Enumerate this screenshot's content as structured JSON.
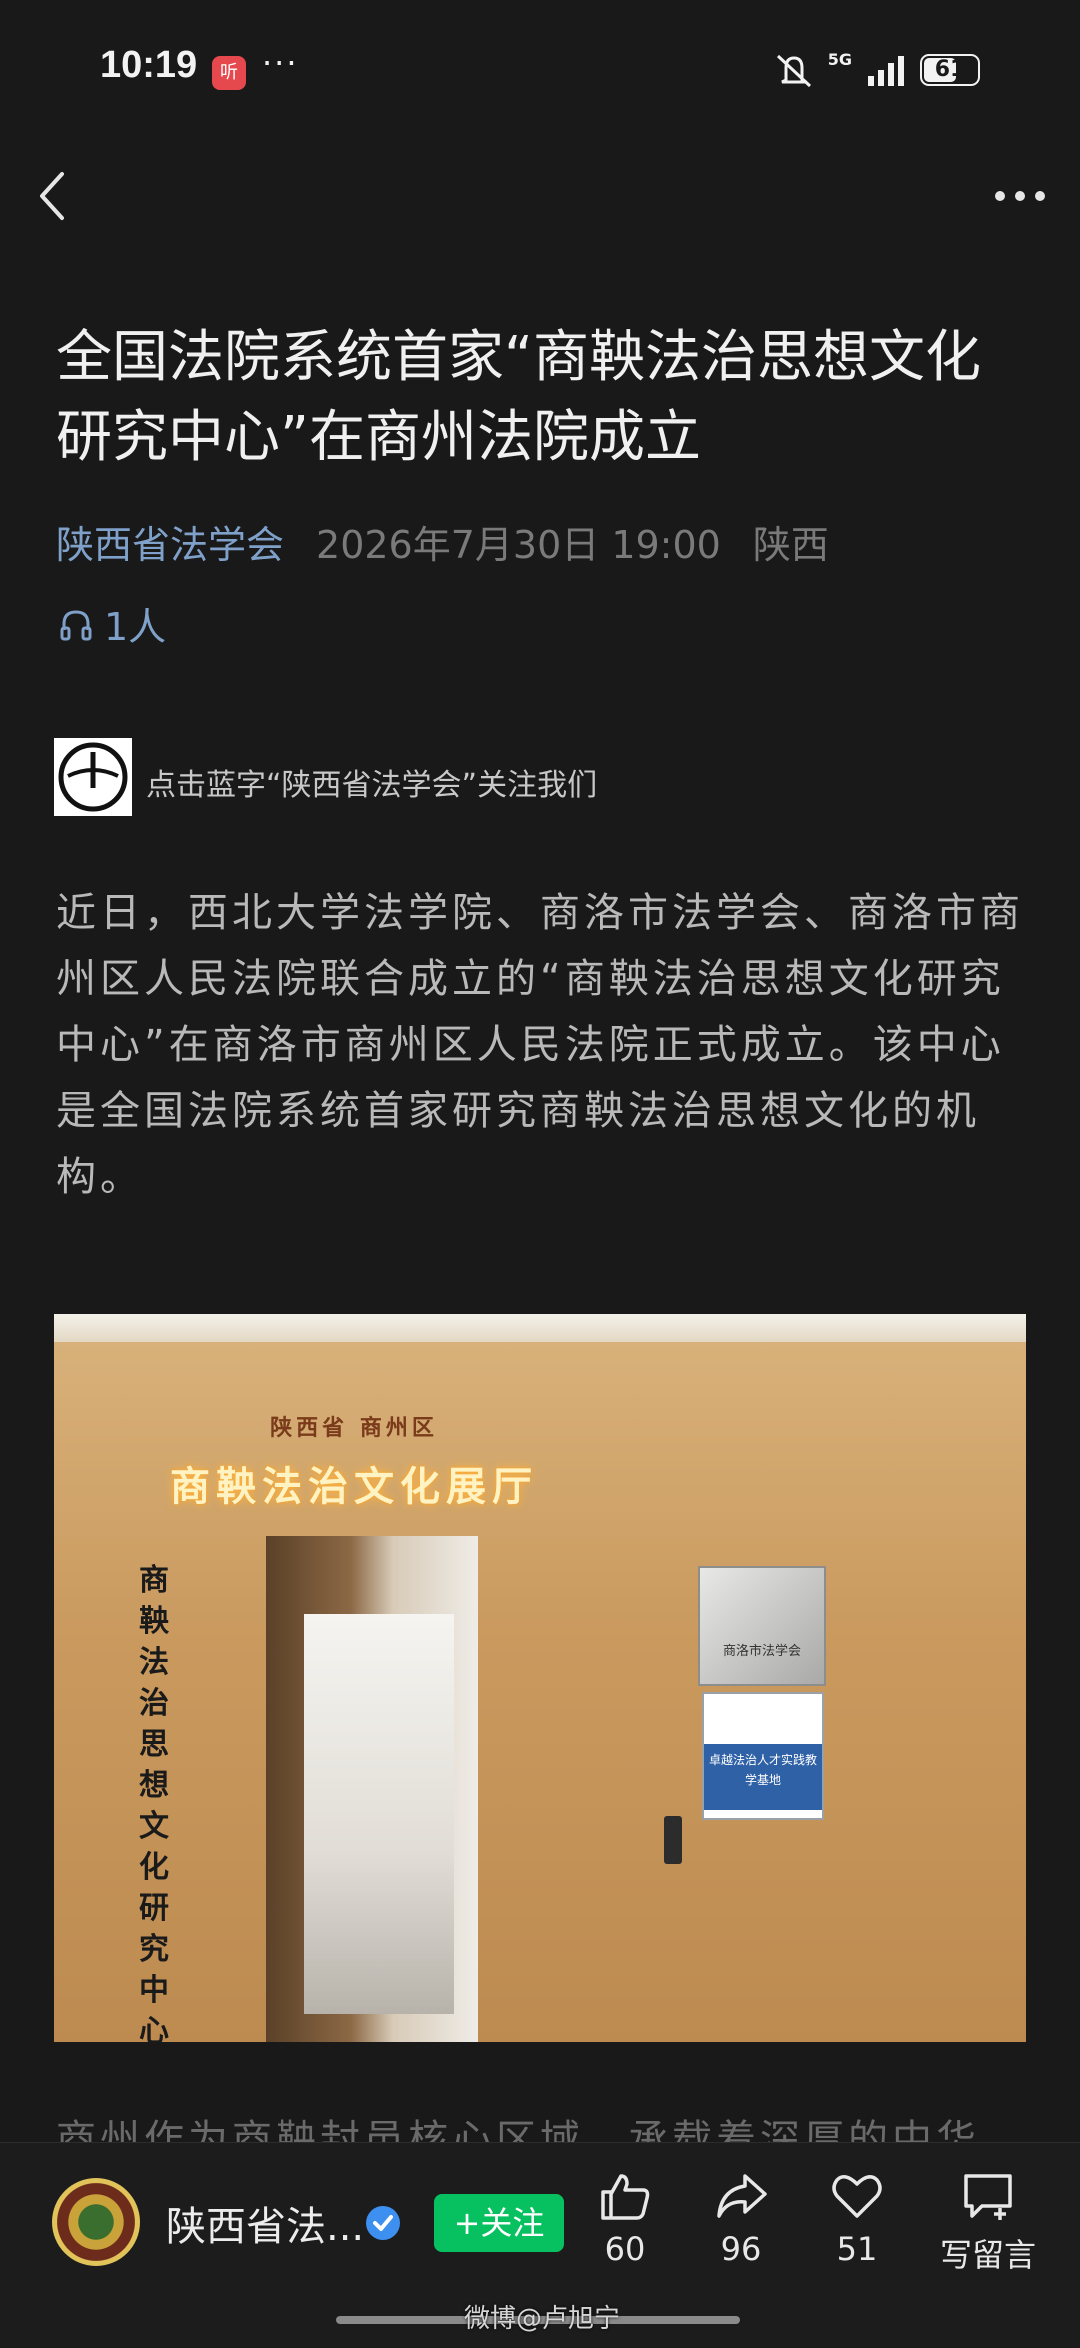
{
  "status_bar": {
    "time": "10:19",
    "app_icon_label": "听",
    "more": "···",
    "network": "5G",
    "battery": "61",
    "battery_level": 0.61
  },
  "article": {
    "title": "全国法院系统首家“商鞅法治思想文化研究中心”在商州法院成立",
    "author": "陕西省法学会",
    "datetime": "2026年7月30日 19:00",
    "location": "陕西",
    "listeners": "1人",
    "follow_prompt": "点击蓝字“陕西省法学会”关注我们",
    "paragraph_1": "近日，西北大学法学院、商洛市法学会、商洛市商州区人民法院联合成立的“商鞅法治思想文化研究中心”在商洛市商州区人民法院正式成立。该中心是全国法院系统首家研究商鞅法治思想文化的机构。",
    "paragraph_2_peek": "商州作为商鞅封邑核心区域，承载着深厚的中华",
    "photo": {
      "sign_small": "陕西省 商州区",
      "sign_main": "商鞅法治文化展厅",
      "vertical_sign": "商鞅法治思想文化研究中心",
      "plaque_1": "商洛市法学会",
      "plaque_2": "卓越法治人才实践教学基地"
    }
  },
  "bottom_bar": {
    "account_name": "陕西省法...",
    "follow_label": "+关注",
    "like_count": "60",
    "share_count": "96",
    "favorite_count": "51",
    "comment_label": "写留言"
  },
  "watermark": "微博@卢旭宁",
  "colors": {
    "background": "#191919",
    "link_blue": "#7fa1c9",
    "follow_green": "#07c160",
    "verified_blue": "#3d8ff0"
  }
}
